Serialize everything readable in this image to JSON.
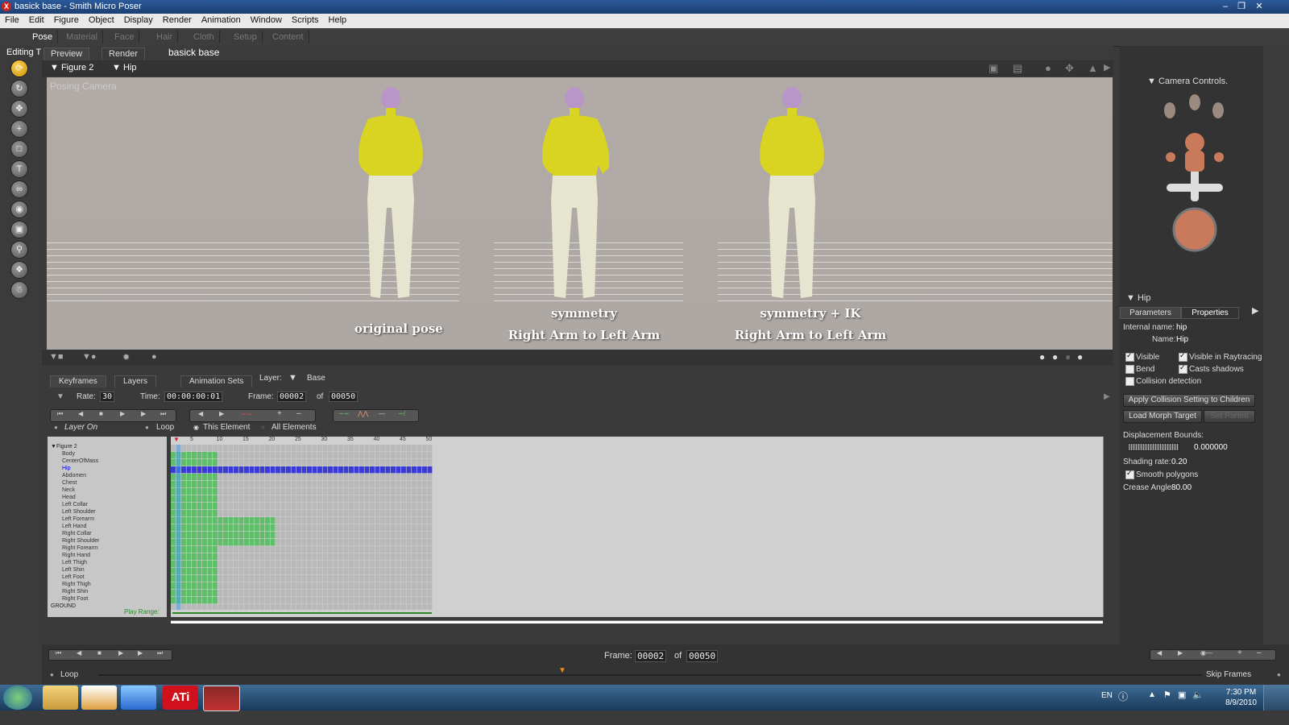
{
  "window": {
    "title": "basick base - Smith Micro Poser"
  },
  "menu": [
    "File",
    "Edit",
    "Figure",
    "Object",
    "Display",
    "Render",
    "Animation",
    "Window",
    "Scripts",
    "Help"
  ],
  "rooms": [
    "Pose",
    "Material",
    "Face",
    "Hair",
    "Cloth",
    "Setup",
    "Content"
  ],
  "editing_label": "Editing T",
  "document_title": "basick base",
  "viewport": {
    "tabs": [
      "Preview",
      "Render"
    ],
    "figure_selector": "Figure 2",
    "actor_selector": "Hip",
    "camera_label": "Posing Camera",
    "captions": {
      "c1": "original pose",
      "c2a": "symmetry",
      "c2b": "Right Arm to Left Arm",
      "c3a": "symmetry + IK",
      "c3b": "Right Arm to Left Arm"
    }
  },
  "right_panel": {
    "camera_controls_label": "Camera Controls.",
    "actor_title": "Hip",
    "tabs": [
      "Parameters",
      "Properties"
    ],
    "internal_name_label": "Internal name:",
    "internal_name_value": "hip",
    "name_label": "Name:",
    "name_value": "Hip",
    "visible_label": "Visible",
    "visible_raytracing_label": "Visible in Raytracing",
    "bend_label": "Bend",
    "casts_shadows_label": "Casts shadows",
    "collision_label": "Collision detection",
    "apply_collision_button": "Apply Collision Setting to Children",
    "load_morph_button": "Load Morph Target",
    "set_parent_button": "Set Parent",
    "displacement_label": "Displacement Bounds:",
    "displacement_value": "0.000000",
    "shading_rate_label": "Shading rate:",
    "shading_rate_value": "0.20",
    "smooth_polygons_label": "Smooth polygons",
    "crease_angle_label": "Crease Angle",
    "crease_angle_value": "80.00"
  },
  "keyframes": {
    "tabs": [
      "Keyframes",
      "Layers",
      "Animation Sets"
    ],
    "layer_label": "Layer:",
    "layer_value": "Base",
    "rate_label": "Rate:",
    "rate_value": "30",
    "time_label": "Time:",
    "time_value": "00:00:00:01",
    "frame_label": "Frame:",
    "frame_value": "00002",
    "of_label": "of",
    "frame_total": "00050",
    "layer_on_label": "Layer On",
    "loop_label": "Loop",
    "this_element_label": "This Element",
    "all_elements_label": "All Elements",
    "ruler": [
      "5",
      "10",
      "15",
      "20",
      "25",
      "30",
      "35",
      "40",
      "45",
      "50"
    ],
    "play_range_label": "Play Range:",
    "tree_root": "Figure 2",
    "tree_items": [
      "Body",
      "CenterOfMass",
      "Hip",
      "Abdomen",
      "Chest",
      "Neck",
      "Head",
      "Left Collar",
      "Left Shoulder",
      "Left Forearm",
      "Left Hand",
      "Right Collar",
      "Right Shoulder",
      "Right Forearm",
      "Right Hand",
      "Left Thigh",
      "Left Shin",
      "Left Foot",
      "Right Thigh",
      "Right Shin",
      "Right Foot",
      "GROUND"
    ],
    "selected_item": "Hip"
  },
  "anim_bar": {
    "frame_label": "Frame:",
    "frame_value": "00002",
    "of_label": "of",
    "frame_total": "00050",
    "loop_label": "Loop",
    "skip_frames_label": "Skip Frames"
  },
  "taskbar": {
    "language": "EN",
    "time": "7:30 PM",
    "date": "8/9/2010",
    "apps": [
      "start-orb",
      "windows-explorer",
      "media-player",
      "internet-explorer",
      "ati-catalyst",
      "poser"
    ]
  },
  "colors": {
    "figure_top": "#d9d321",
    "figure_bottom": "#e6e5cf",
    "keyframe_green": "#5fbe6a",
    "selected_row_blue": "#3a3ad6"
  }
}
